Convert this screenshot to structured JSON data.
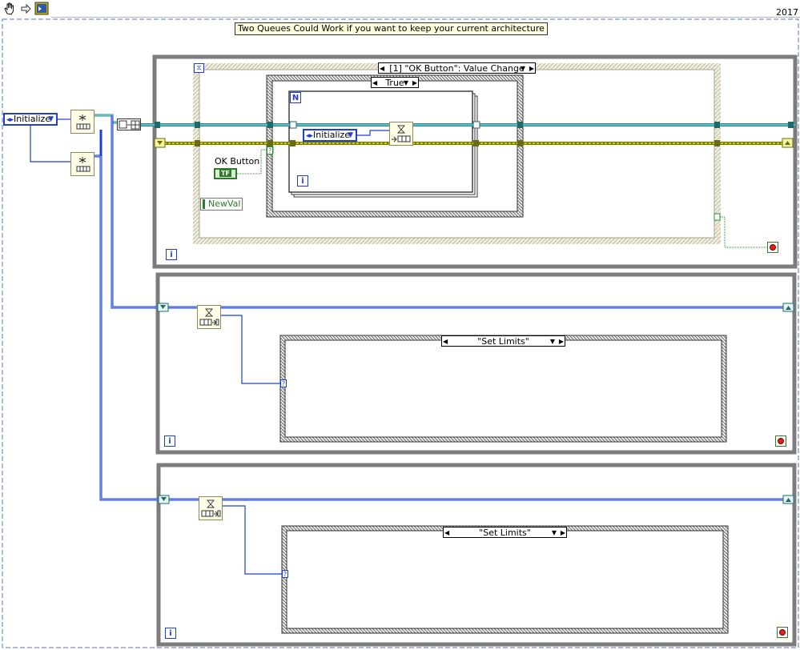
{
  "toolbar": {
    "version": "2017"
  },
  "comment": "Two Queues Could Work if you want to keep your current architecture",
  "init_enum": "Initialize",
  "inner_enum": "Initialize",
  "event_selector": "[1] \"OK Button\": Value Change",
  "case_selector_top": "True",
  "ok_button_label": "OK Button",
  "ok_button_terminal": "TF",
  "newval_label": "NewVal",
  "for_loop_count": "N",
  "iteration_terminal": "i",
  "case_selector_mid": "\"Set Limits\"",
  "case_selector_bottom": "\"Set Limits\"",
  "colors": {
    "wire_queue": "#1e8a8a",
    "wire_error": "#cccc00",
    "wire_enum": "#1f3fcc",
    "loop_border": "#7c7c7c"
  }
}
